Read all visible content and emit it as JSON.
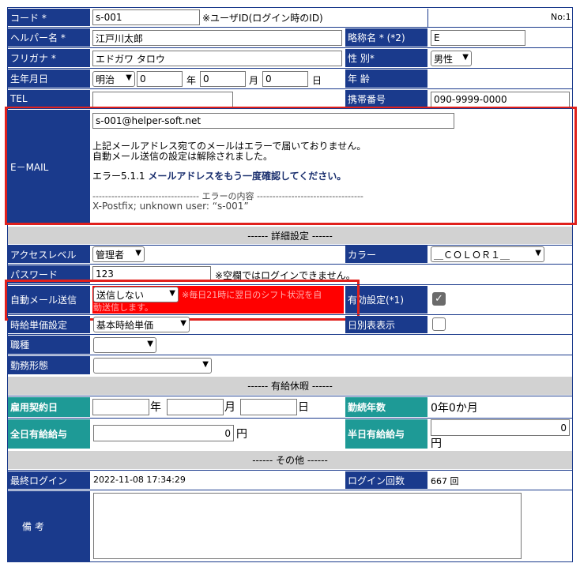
{
  "form": {
    "code": {
      "label": "コード *",
      "value": "s-001",
      "note": "※ユーザID(ログイン時のID)",
      "number": "No:1"
    },
    "helper_name": {
      "label": "ヘルパー名 *",
      "value": "江戸川太郎"
    },
    "abbr": {
      "label": "略称名 * (*2)",
      "value": "E"
    },
    "furigana": {
      "label": "フリガナ *",
      "value": "エドガワ タロウ"
    },
    "gender": {
      "label": "性 別*",
      "value": "男性"
    },
    "birth": {
      "label": "生年月日",
      "era": "明治",
      "year": "0",
      "year_unit": "年",
      "month": "0",
      "month_unit": "月",
      "day": "0",
      "day_unit": "日"
    },
    "age": {
      "label": "年 齢"
    },
    "tel": {
      "label": "TEL",
      "value": ""
    },
    "mobile": {
      "label": "携帯番号",
      "value": "090-9999-0000"
    },
    "email": {
      "label": "E－MAIL",
      "value": "s-001@helper-soft.net",
      "msg1": "上記メールアドレス宛てのメールはエラーで届いておりません。",
      "msg2": "自動メール送信の設定は解除されました。",
      "err_prefix": "エラー5.1.1 ",
      "err_bold": "メールアドレスをもう一度確認してください。",
      "err_divider": "---------------------------------- エラーの内容 ----------------------------------",
      "err_detail": "X-Postfix; unknown user: “s-001”"
    },
    "section_detail": "------ 詳細設定 ------",
    "access": {
      "label": "アクセスレベル",
      "value": "管理者"
    },
    "color": {
      "label": "カラー",
      "value": "＿ＣＯＬＯＲ１＿"
    },
    "password": {
      "label": "パスワード",
      "value": "123",
      "note": "※空欄ではログインできません。"
    },
    "auto_mail": {
      "label": "自動メール送信",
      "value": "送信しない",
      "note_line1": "※毎日21時に翌日のシフト状況を自",
      "note_line2": "動送信します。"
    },
    "valid": {
      "label": "有効設定(*1)",
      "checked": true
    },
    "hourly": {
      "label": "時給単価設定",
      "value": "基本時給単価"
    },
    "daily_list": {
      "label": "日別表表示",
      "checked": false
    },
    "job": {
      "label": "職種",
      "value": ""
    },
    "work_style": {
      "label": "勤務形態",
      "value": ""
    },
    "section_leave": "------ 有給休暇 ------",
    "hire_date": {
      "label": "雇用契約日",
      "year_unit": "年",
      "month_unit": "月",
      "day_unit": "日"
    },
    "years": {
      "label": "勤続年数",
      "value": "0年0か月"
    },
    "full_pay": {
      "label": "全日有給給与",
      "value": "0",
      "unit": "円"
    },
    "half_pay": {
      "label": "半日有給給与",
      "value": "0",
      "unit": "円"
    },
    "section_other": "------ その他 ------",
    "last_login": {
      "label": "最終ログイン",
      "value": "2022-11-08 17:34:29"
    },
    "login_count": {
      "label": "ログイン回数",
      "value": "667 回"
    },
    "remarks": {
      "label": "備 考"
    }
  },
  "icons": {
    "dropdown": "chevron-down-icon",
    "check": "checkmark-icon"
  },
  "colors": {
    "header_bg": "#1a3a8c",
    "teal_bg": "#1e9a96",
    "section_bg": "#d2d2d2",
    "alert_bg": "#ff0000",
    "highlight_border": "#e0201c"
  }
}
